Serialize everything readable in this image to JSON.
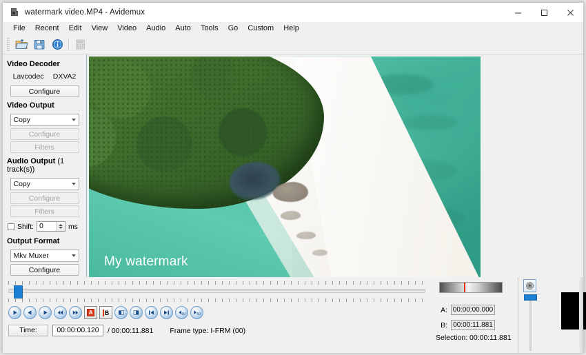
{
  "window": {
    "title": "watermark video.MP4 - Avidemux",
    "app_icon": "avidemux-icon",
    "controls": {
      "minimize": "minimize-icon",
      "maximize": "maximize-icon",
      "close": "close-icon"
    }
  },
  "menubar": {
    "items": [
      "File",
      "Recent",
      "Edit",
      "View",
      "Video",
      "Audio",
      "Auto",
      "Tools",
      "Go",
      "Custom",
      "Help"
    ]
  },
  "toolbar": {
    "buttons": [
      {
        "name": "open-file-icon",
        "enabled": true
      },
      {
        "name": "save-file-icon",
        "enabled": true
      },
      {
        "name": "info-icon",
        "enabled": true
      },
      {
        "name": "calculator-icon",
        "enabled": false
      }
    ]
  },
  "sidebar": {
    "video_decoder": {
      "title": "Video Decoder",
      "codec": "Lavcodec",
      "acceleration": "DXVA2",
      "configure_label": "Configure"
    },
    "video_output": {
      "title": "Video Output",
      "mode": "Copy",
      "configure_label": "Configure",
      "filters_label": "Filters"
    },
    "audio_output": {
      "title": "Audio Output",
      "title_suffix": " (1 track(s))",
      "mode": "Copy",
      "configure_label": "Configure",
      "filters_label": "Filters",
      "shift_label": "Shift:",
      "shift_value": "0",
      "shift_unit": "ms",
      "shift_checked": false
    },
    "output_format": {
      "title": "Output Format",
      "muxer": "Mkv Muxer",
      "configure_label": "Configure"
    }
  },
  "video_preview": {
    "watermark_text": "My watermark",
    "description": "aerial-beach-mangrove-turquoise-water"
  },
  "timeline": {
    "position_percent": 1,
    "slider_name": "timeline-slider"
  },
  "transport": {
    "buttons": [
      "play-button",
      "previous-frame-button",
      "next-frame-button",
      "rewind-button",
      "forward-button",
      "mark-a-button",
      "mark-b-button",
      "go-to-marker-a-button",
      "go-to-marker-b-button",
      "previous-keyframe-button",
      "next-keyframe-button",
      "back-50-frames-button",
      "forward-50-frames-button"
    ],
    "mark_a_letter": "A",
    "mark_b_letter": "B"
  },
  "status": {
    "time_label": "Time:",
    "current_time": "00:00:00.120",
    "total_time": "/ 00:00:11.881",
    "frame_type_label": "Frame type:",
    "frame_type_value": "I-FRM (00)"
  },
  "selection": {
    "a_label": "A:",
    "a_value": "00:00:00.000",
    "b_label": "B:",
    "b_value": "00:00:11.881",
    "selection_text": "Selection: 00:00:11.881"
  },
  "volume": {
    "icon": "speaker-icon",
    "level_percent": 92
  },
  "colors": {
    "accent_blue": "#1b7fd4",
    "marker_red": "#e03a1c",
    "window_bg": "#f0f0f0",
    "titlebar_bg": "#ffffff"
  }
}
